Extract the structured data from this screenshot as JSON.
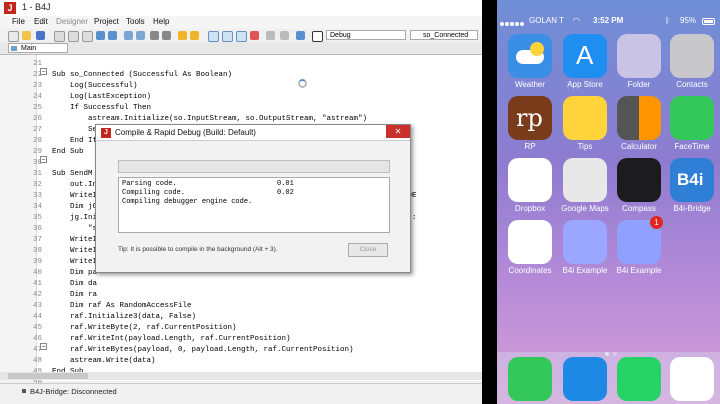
{
  "ide": {
    "window_title": "1 - B4J",
    "app_icon": "J",
    "menu": [
      "File",
      "Edit",
      "Designer",
      "Project",
      "Tools",
      "Help"
    ],
    "toolbar": {
      "config_dropdown": "Debug",
      "module_dropdown": "so_Connected"
    },
    "tab_label": "Main",
    "status_text": "B4J-Bridge: Disconnected"
  },
  "code": {
    "lines": [
      {
        "n": "21",
        "t": ""
      },
      {
        "n": "22",
        "t": "Sub so_Connected (Successful As Boolean)"
      },
      {
        "n": "23",
        "t": "    Log(Successful)"
      },
      {
        "n": "24",
        "t": "    Log(LastException)"
      },
      {
        "n": "25",
        "t": "    If Successful Then"
      },
      {
        "n": "26",
        "t": "        astream.Initialize(so.InputStream, so.OutputStream, \"astream\")"
      },
      {
        "n": "27",
        "t": "        SendMessage"
      },
      {
        "n": "28",
        "t": "    End If"
      },
      {
        "n": "29",
        "t": "End Sub"
      },
      {
        "n": "30",
        "t": ""
      },
      {
        "n": "31",
        "t": "Sub SendM"
      },
      {
        "n": "32",
        "t": "    out.In"
      },
      {
        "n": "33",
        "t": "    WriteI                                                        3079909EAF593DE"
      },
      {
        "n": "34",
        "t": "    Dim jG"
      },
      {
        "n": "35",
        "t": "    jg.Ini                                                       ssage\", \"sound\":"
      },
      {
        "n": "36",
        "t": "        \"s"
      },
      {
        "n": "37",
        "t": "    WriteI"
      },
      {
        "n": "38",
        "t": "    WriteI"
      },
      {
        "n": "39",
        "t": "    WriteI"
      },
      {
        "n": "40",
        "t": "    Dim pa"
      },
      {
        "n": "41",
        "t": "    Dim da"
      },
      {
        "n": "42",
        "t": "    Dim ra"
      },
      {
        "n": "43",
        "t": "    Dim raf As RandomAccessFile"
      },
      {
        "n": "44",
        "t": "    raf.Initialize3(data, False)"
      },
      {
        "n": "45",
        "t": "    raf.WriteByte(2, raf.CurrentPosition)"
      },
      {
        "n": "46",
        "t": "    raf.WriteInt(payload.Length, raf.CurrentPosition)"
      },
      {
        "n": "47",
        "t": "    raf.WriteBytes(payload, 0, payload.Length, raf.CurrentPosition)"
      },
      {
        "n": "48",
        "t": "    astream.Write(data)"
      },
      {
        "n": "49",
        "t": "End Sub"
      },
      {
        "n": "50",
        "t": ""
      },
      {
        "n": "51",
        "t": "Sub WriteItem(id As Byte, data() As Byte)"
      },
      {
        "n": "52",
        "t": "    out.WriteBytes(Array As Byte(id), 0, 1)"
      },
      {
        "n": "53",
        "t": "    out.WriteBytes(bc.ShortsToBytes(Array As Short(data.Length)), 0, 2)"
      }
    ]
  },
  "dialog": {
    "icon": "J",
    "title": "Compile & Rapid Debug (Build: Default)",
    "close_glyph": "✕",
    "log": [
      {
        "label": "Parsing code.",
        "value": "0.01"
      },
      {
        "label": "Compiling code.",
        "value": "0.02"
      },
      {
        "label": "Compiling debugger engine code.",
        "value": ""
      }
    ],
    "tip": "Tip: It is possible to compile in the background (Alt + 3).",
    "close_button": "Close"
  },
  "phone": {
    "carrier": "GOLAN T",
    "time": "3:52 PM",
    "battery_text": "95%",
    "battery_level": 0.95,
    "apps": [
      {
        "label": "Weather",
        "icon": "weather-icon",
        "color": "#3a8ee6"
      },
      {
        "label": "App Store",
        "icon": "app-store-icon",
        "color": "#1f8ef1"
      },
      {
        "label": "Folder",
        "icon": "folder-icon",
        "color": "#c9c3e6"
      },
      {
        "label": "Contacts",
        "icon": "contacts-icon",
        "color": "#c7c7cc"
      },
      {
        "label": "RP",
        "icon": "rp-icon",
        "color": "#7a3b1a"
      },
      {
        "label": "Tips",
        "icon": "tips-icon",
        "color": "#ffd43b"
      },
      {
        "label": "Calculator",
        "icon": "calculator-icon",
        "color": "#ff9500"
      },
      {
        "label": "FaceTime",
        "icon": "facetime-icon",
        "color": "#34c759"
      },
      {
        "label": "Dropbox",
        "icon": "dropbox-icon",
        "color": "#ffffff"
      },
      {
        "label": "Google Maps",
        "icon": "google-maps-icon",
        "color": "#e8e8e8"
      },
      {
        "label": "Compass",
        "icon": "compass-icon",
        "color": "#1c1c1e"
      },
      {
        "label": "B4i-Bridge",
        "icon": "b4i-bridge-icon",
        "color": "#2f7fd6"
      },
      {
        "label": "Coordinates",
        "icon": "coordinates-icon",
        "color": "#ffffff"
      },
      {
        "label": "B4i Example",
        "icon": "b4i-example-icon",
        "color": "#9aa6ff"
      },
      {
        "label": "B4i Example",
        "icon": "b4i-example-icon",
        "color": "#8fa0ff"
      }
    ],
    "badge": "1",
    "rp_text": "rp",
    "b4i_text": "B4i",
    "dock": [
      {
        "icon": "phone-icon",
        "color": "#34c759"
      },
      {
        "icon": "mail-icon",
        "color": "#1e88e5"
      },
      {
        "icon": "whatsapp-icon",
        "color": "#25d366"
      },
      {
        "icon": "safari-icon",
        "color": "#ffffff"
      }
    ]
  }
}
